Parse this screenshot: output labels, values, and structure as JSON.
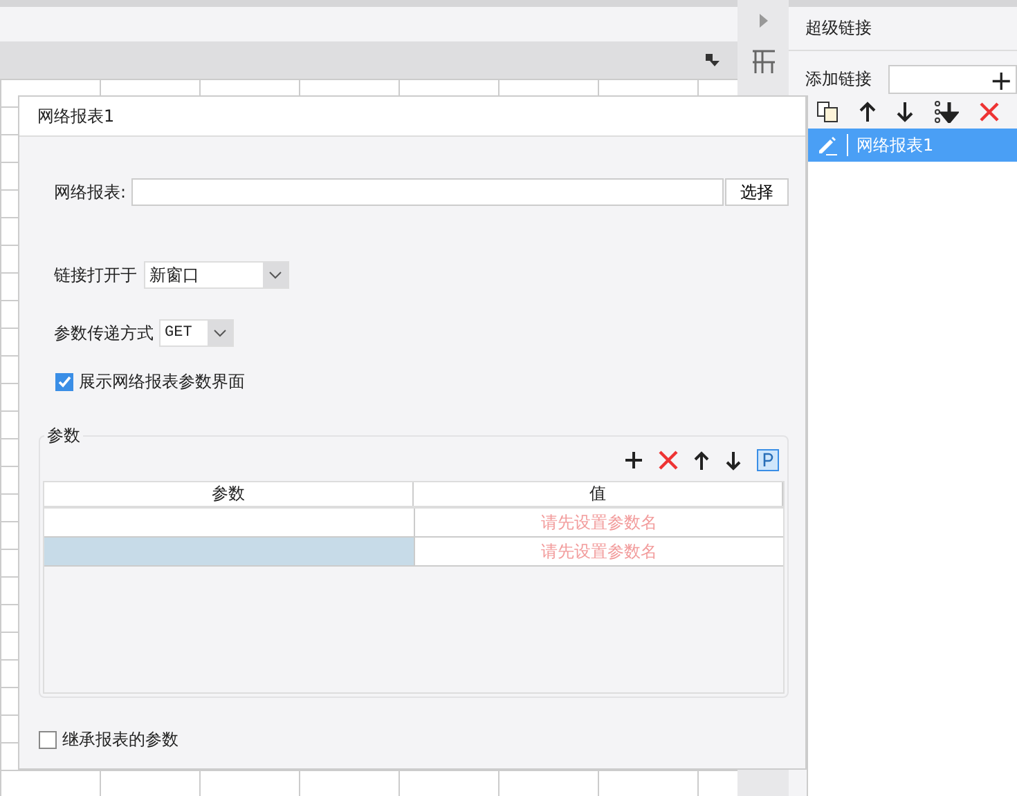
{
  "side_panel": {
    "title": "超级链接",
    "add_label": "添加链接",
    "add_button": "+",
    "links": [
      {
        "name": "网络报表1",
        "selected": true
      }
    ]
  },
  "dialog": {
    "title": "网络报表1",
    "report_label": "网络报表:",
    "choose_button": "选择",
    "open_label": "链接打开于",
    "open_value": "新窗口",
    "method_label": "参数传递方式",
    "method_value": "GET",
    "show_params": {
      "label": "展示网络报表参数界面",
      "checked": true
    },
    "params": {
      "title": "参数",
      "columns": [
        "参数",
        "值"
      ],
      "rows": [
        {
          "value": "请先设置参数名",
          "selected": false
        },
        {
          "value": "请先设置参数名",
          "selected": true
        }
      ]
    },
    "inherit": {
      "label": "继承报表的参数",
      "checked": false
    }
  }
}
